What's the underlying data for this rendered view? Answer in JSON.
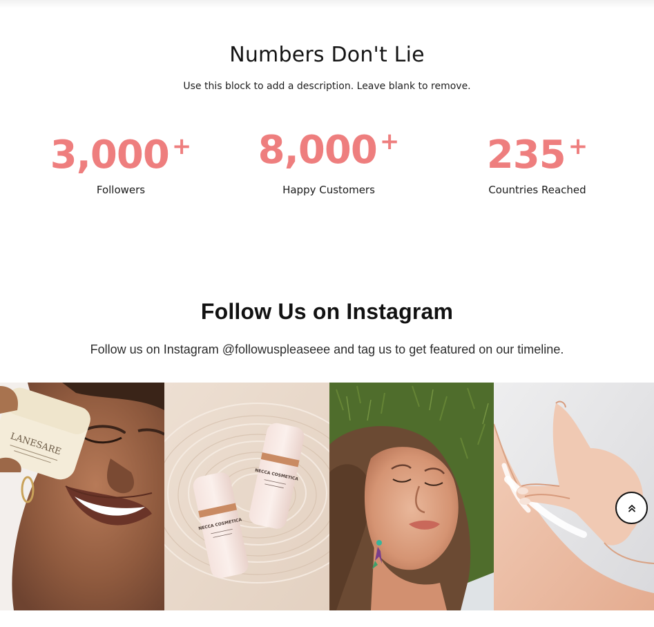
{
  "numbers_section": {
    "title": "Numbers Don't Lie",
    "description": "Use this block to add a description. Leave blank to remove.",
    "stats": [
      {
        "value": "3,000",
        "suffix": "+",
        "label": "Followers"
      },
      {
        "value": "8,000",
        "suffix": "+",
        "label": "Happy Customers"
      },
      {
        "value": "235",
        "suffix": "+",
        "label": "Countries Reached"
      }
    ],
    "accent_color": "#ee7e7e"
  },
  "instagram_section": {
    "title": "Follow Us on Instagram",
    "description": "Follow us on Instagram @followuspleaseee and tag us to get featured on our timeline.",
    "photos": [
      {
        "subject": "woman-with-cream-jar",
        "jar_text": "LANESARE"
      },
      {
        "subject": "serum-bottles-in-water",
        "bottle_text": "NECCA COSMETICA"
      },
      {
        "subject": "woman-on-grass"
      },
      {
        "subject": "hands-applying-cream"
      }
    ]
  },
  "scroll_top_button": {
    "icon": "double-chevron-up-icon"
  }
}
